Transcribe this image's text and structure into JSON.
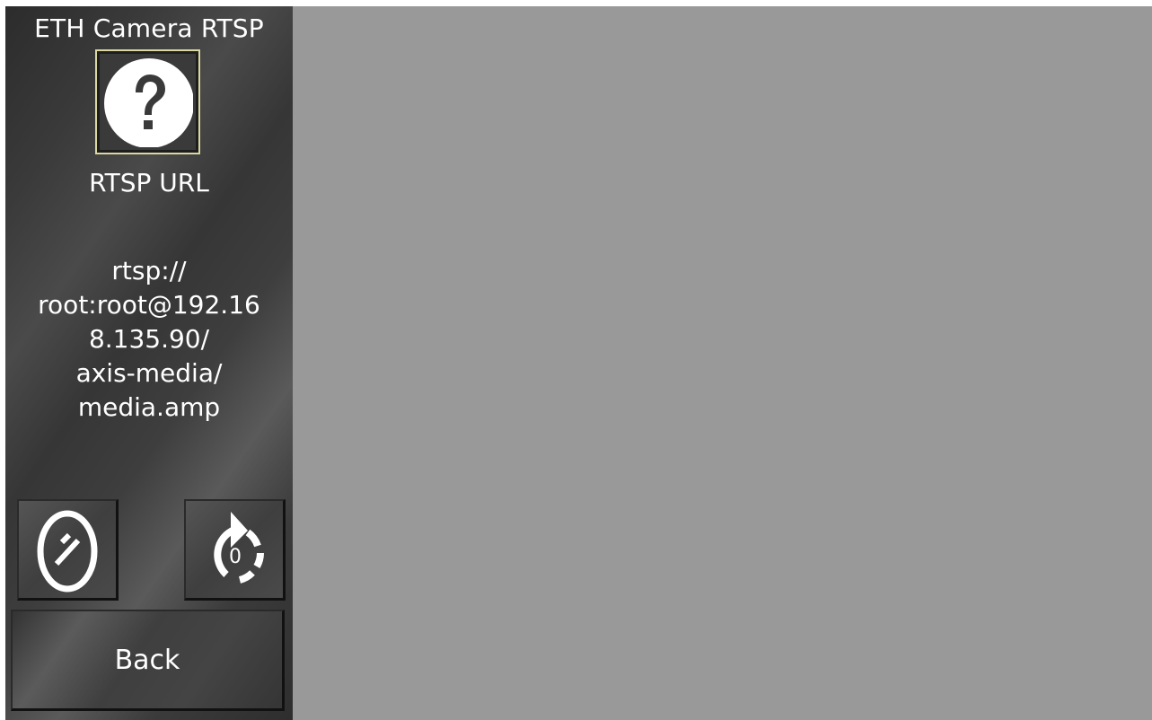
{
  "sidebar": {
    "title": "ETH Camera RTSP",
    "help_icon": "question-mark-circle-icon",
    "url_label": "RTSP URL",
    "url_lines": [
      "rtsp://",
      "root:root@192.16",
      "8.135.90/",
      "axis-media/",
      "media.amp"
    ],
    "edit_icon": "edit-pencil-oval-icon",
    "reset_icon": "reset-rotate-icon",
    "reset_counter": "0",
    "back_label": "Back"
  },
  "colors": {
    "video_area": "#999999",
    "help_border": "#dad7a0",
    "text": "#ffffff"
  }
}
